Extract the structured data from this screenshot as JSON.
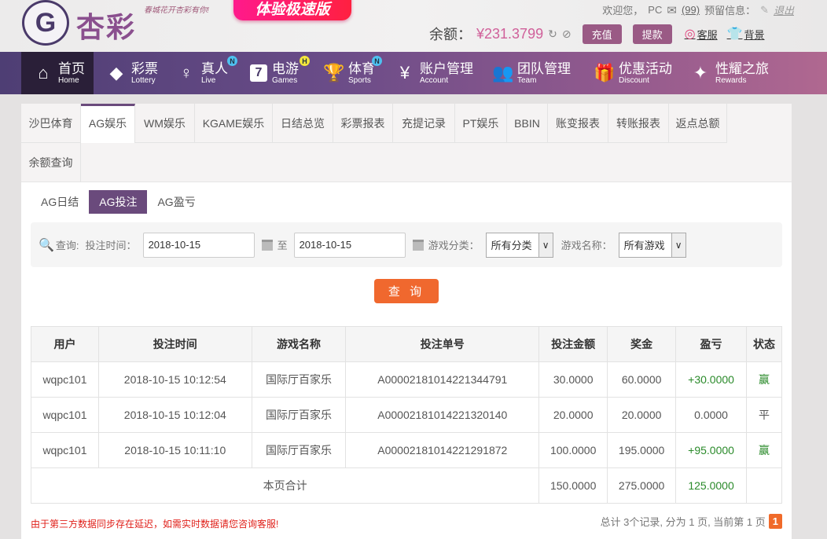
{
  "header": {
    "logo_mark": "G",
    "logo_text": "杏彩",
    "slogan": "春城花开杏彩有你!",
    "promo": "体验极速版",
    "welcome": "欢迎您，",
    "user": "PC",
    "messages": "(99)",
    "reserved": "预留信息：",
    "logout": "退出",
    "balance_label": "余额：",
    "balance": "¥231.3799",
    "recharge": "充值",
    "withdraw": "提款",
    "service": "客服",
    "background": "背景"
  },
  "nav": [
    {
      "cn": "首页",
      "en": "Home"
    },
    {
      "cn": "彩票",
      "en": "Lottery"
    },
    {
      "cn": "真人",
      "en": "Live",
      "badge": "N"
    },
    {
      "cn": "电游",
      "en": "Games",
      "badge": "H"
    },
    {
      "cn": "体育",
      "en": "Sports",
      "badge": "N"
    },
    {
      "cn": "账户管理",
      "en": "Account"
    },
    {
      "cn": "团队管理",
      "en": "Team"
    },
    {
      "cn": "优惠活动",
      "en": "Discount"
    },
    {
      "cn": "性耀之旅",
      "en": "Rewards"
    }
  ],
  "tabs": [
    "沙巴体育",
    "AG娱乐",
    "WM娱乐",
    "KGAME娱乐",
    "日结总览",
    "彩票报表",
    "充提记录",
    "PT娱乐",
    "BBIN",
    "账变报表",
    "转账报表",
    "返点总额",
    "余额查询"
  ],
  "subtabs": [
    "AG日结",
    "AG投注",
    "AG盈亏"
  ],
  "filter": {
    "query_label": "查询:",
    "time_label": "投注时间：",
    "start": "2018-10-15",
    "to": "至",
    "end": "2018-10-15",
    "category_label": "游戏分类：",
    "category": "所有分类",
    "name_label": "游戏名称：",
    "name": "所有游戏",
    "button": "查 询"
  },
  "table": {
    "headers": [
      "用户",
      "投注时间",
      "游戏名称",
      "投注单号",
      "投注金额",
      "奖金",
      "盈亏",
      "状态"
    ],
    "rows": [
      [
        "wqpc101",
        "2018-10-15 10:12:54",
        "国际厅百家乐",
        "A00002181014221344791",
        "30.0000",
        "60.0000",
        "+30.0000",
        "赢"
      ],
      [
        "wqpc101",
        "2018-10-15 10:12:04",
        "国际厅百家乐",
        "A00002181014221320140",
        "20.0000",
        "20.0000",
        "0.0000",
        "平"
      ],
      [
        "wqpc101",
        "2018-10-15 10:11:10",
        "国际厅百家乐",
        "A00002181014221291872",
        "100.0000",
        "195.0000",
        "+95.0000",
        "赢"
      ]
    ],
    "total": {
      "label": "本页合计",
      "bet": "150.0000",
      "prize": "275.0000",
      "profit": "125.0000"
    }
  },
  "footer": {
    "note": "由于第三方数据同步存在延迟，如需实时数据请您咨询客服!",
    "pager": "总计 3个记录, 分为 1 页, 当前第 1 页",
    "page": "1"
  }
}
